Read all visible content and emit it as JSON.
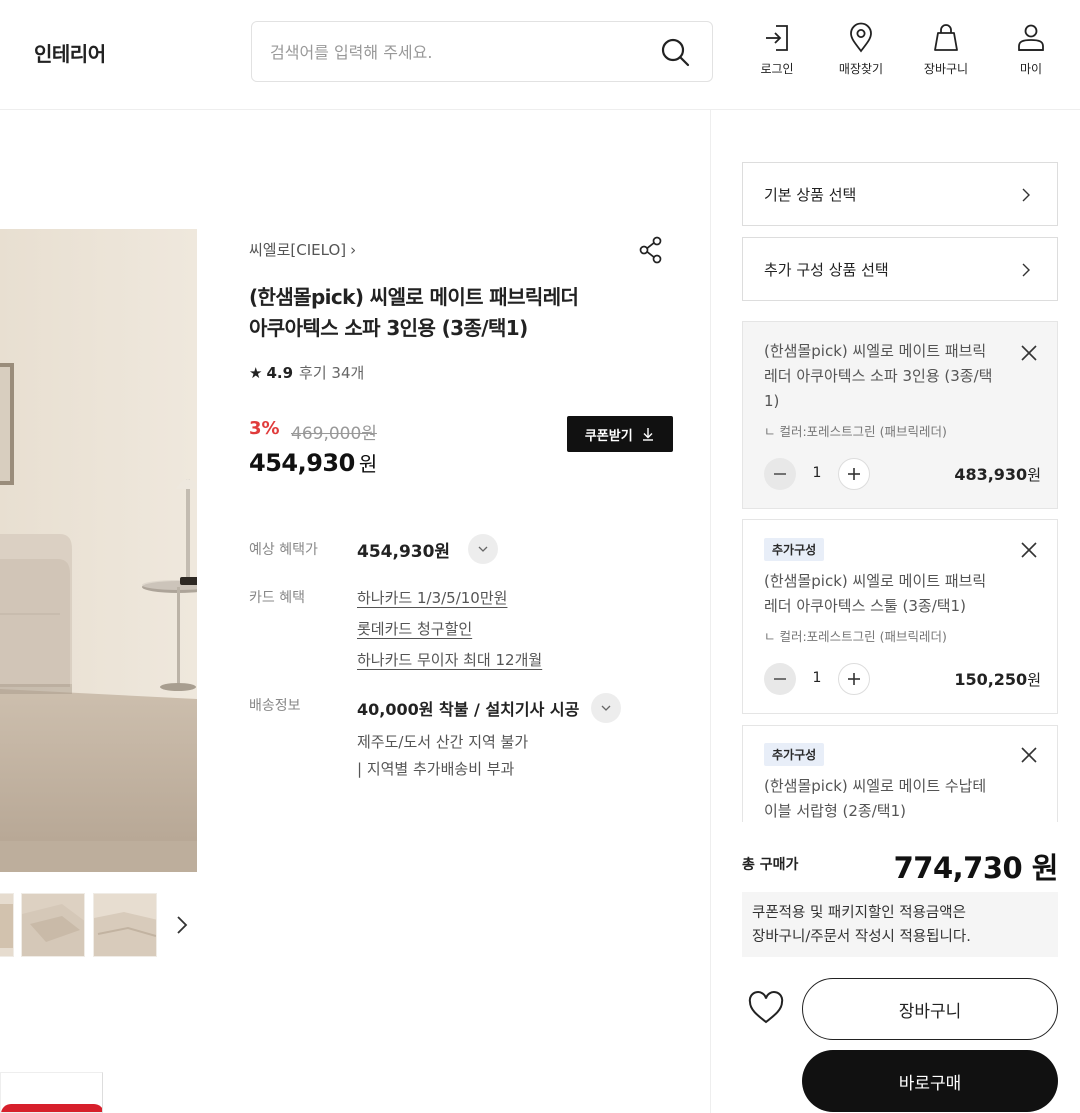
{
  "header": {
    "brand": "인테리어",
    "search_placeholder": "검색어를 입력해 주세요.",
    "nav": [
      {
        "label": "로그인",
        "icon": "login-icon"
      },
      {
        "label": "매장찾기",
        "icon": "location-pin-icon"
      },
      {
        "label": "장바구니",
        "icon": "shopping-bag-icon"
      },
      {
        "label": "마이",
        "icon": "user-icon"
      }
    ]
  },
  "product": {
    "brand": "씨엘로[CIELO]",
    "brand_chevron": "›",
    "title_line1": "(한샘몰pick) 씨엘로 메이트 패브릭레더",
    "title_line2": "아쿠아텍스 소파 3인용 (3종/택1)",
    "rating": "4.9",
    "reviews": "후기 34개",
    "discount": "3%",
    "original_price": "469,000원",
    "sale_price": "454,930",
    "sale_unit": "원",
    "coupon_label": "쿠폰받기"
  },
  "benefits": {
    "expected_label": "예상 혜택가",
    "expected_value": "454,930원",
    "card_label": "카드 혜택",
    "card_links": [
      "하나카드 1/3/5/10만원",
      "롯데카드 청구할인",
      "하나카드 무이자 최대 12개월"
    ],
    "shipping_label": "배송정보",
    "shipping_value": "40,000원 착불 / 설치기사 시공",
    "shipping_note1": "제주도/도서 산간 지역 불가",
    "shipping_note2": "| 지역별 추가배송비 부과"
  },
  "panel": {
    "select_basic": "기본 상품 선택",
    "select_extra": "추가 구성 상품 선택",
    "items": [
      {
        "tag": "",
        "name_line1": "(한샘몰pick) 씨엘로 메이트 패브릭",
        "name_line2": "레더 아쿠아텍스 소파 3인용 (3종/택",
        "name_line3": "1)",
        "option": "ㄴ 컬러:포레스트그린 (패브릭레더)",
        "qty": "1",
        "price": "483,930",
        "unit": "원"
      },
      {
        "tag": "추가구성",
        "name_line1": "(한샘몰pick) 씨엘로 메이트 패브릭",
        "name_line2": "레더 아쿠아텍스 스툴 (3종/택1)",
        "option": "ㄴ 컬러:포레스트그린 (패브릭레더)",
        "qty": "1",
        "price": "150,250",
        "unit": "원"
      },
      {
        "tag": "추가구성",
        "name_line1": "(한샘몰pick) 씨엘로 메이트 수납테",
        "name_line2": "이블 서랍형 (2종/택1)"
      }
    ],
    "total_label": "총 구매가",
    "total_price": "774,730 원",
    "notice_line1": "쿠폰적용 및 패키지할인 적용금액은",
    "notice_line2": "장바구니/주문서 작성시 적용됩니다.",
    "cart_label": "장바구니",
    "buy_label": "바로구매"
  },
  "colors": {
    "accent_red": "#e03b3b",
    "black": "#111111",
    "tag_bg": "#e8eef8"
  }
}
